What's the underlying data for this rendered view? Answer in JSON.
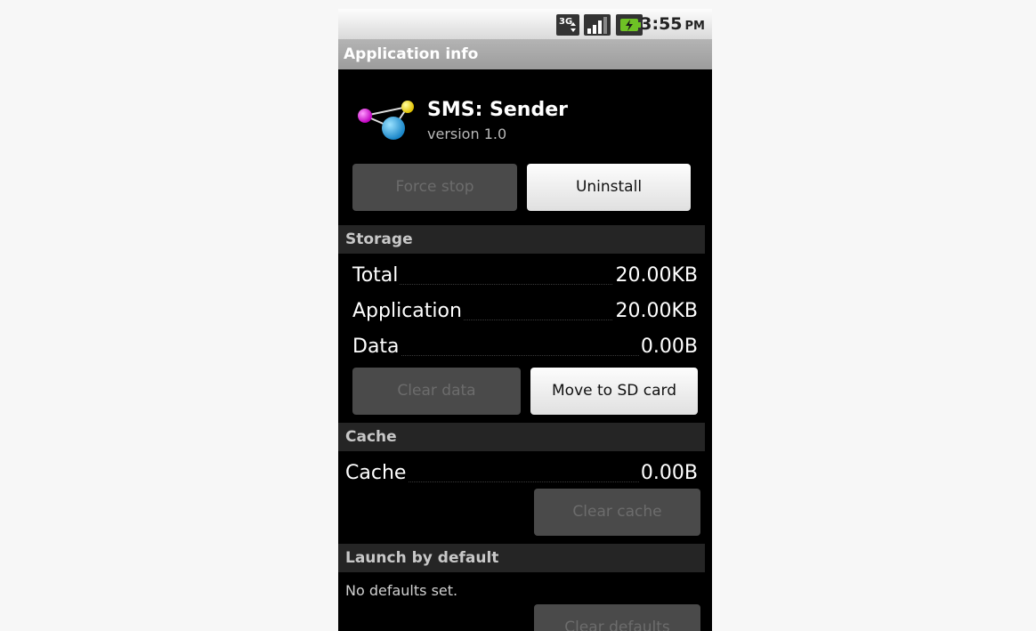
{
  "status_bar": {
    "time": "3:55",
    "ampm": "PM",
    "icons": [
      "3g-data-icon",
      "signal-strength-icon",
      "battery-charging-icon"
    ]
  },
  "title_bar": {
    "title": "Application info"
  },
  "app": {
    "name": "SMS: Sender",
    "version": "version 1.0",
    "icon": "molecule-app-icon"
  },
  "buttons": {
    "force_stop": "Force stop",
    "uninstall": "Uninstall",
    "clear_data": "Clear data",
    "move_to_sd": "Move to SD card",
    "clear_cache": "Clear cache",
    "clear_defaults": "Clear defaults"
  },
  "storage": {
    "header": "Storage",
    "rows": [
      {
        "label": "Total",
        "value": "20.00KB"
      },
      {
        "label": "Application",
        "value": "20.00KB"
      },
      {
        "label": "Data",
        "value": "0.00B"
      }
    ]
  },
  "cache": {
    "header": "Cache",
    "label": "Cache",
    "value": "0.00B"
  },
  "launch": {
    "header": "Launch by default",
    "text": "No defaults set."
  },
  "colors": {
    "background": "#000000",
    "title_bar": "#a6a6a6",
    "section_header": "#252525",
    "disabled_button": "#4a4a4a"
  }
}
